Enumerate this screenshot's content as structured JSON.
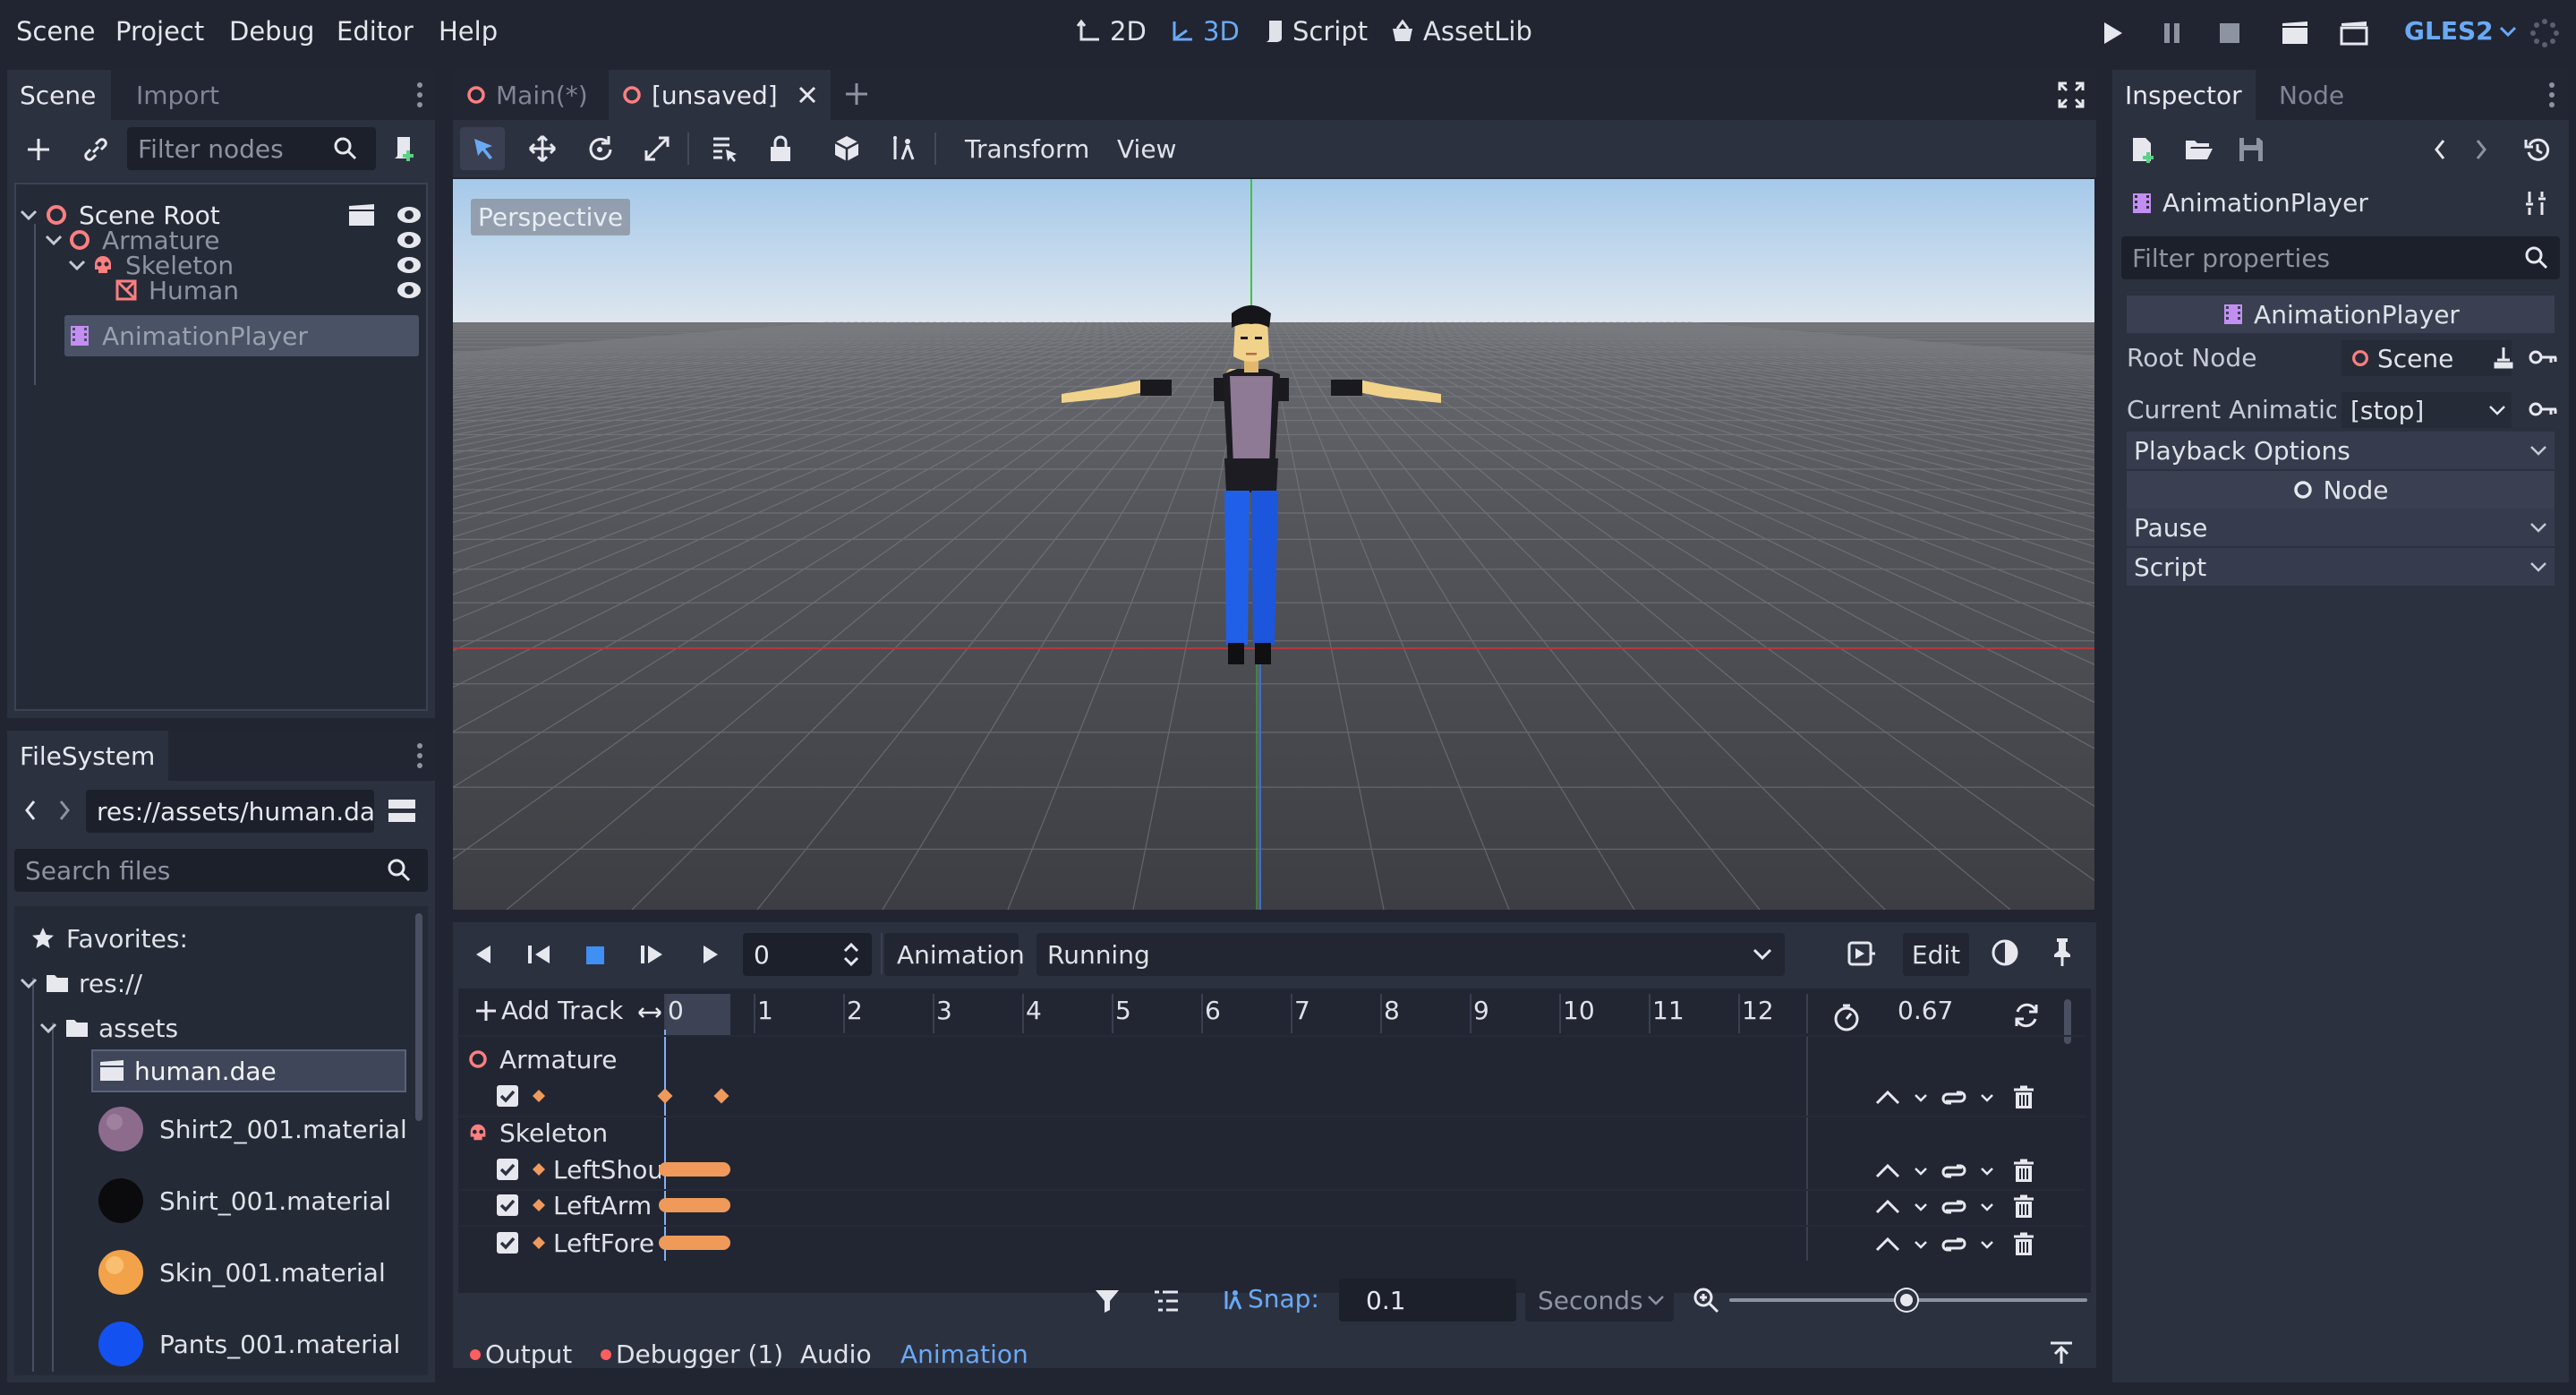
{
  "menu": {
    "items": [
      "Scene",
      "Project",
      "Debug",
      "Editor",
      "Help"
    ]
  },
  "workspaces": {
    "w2d": "2D",
    "w3d": "3D",
    "script": "Script",
    "assetlib": "AssetLib"
  },
  "renderer": "GLES2",
  "scene_dock": {
    "tabs": [
      "Scene",
      "Import"
    ],
    "filter_placeholder": "Filter nodes",
    "tree": [
      {
        "label": "Scene Root"
      },
      {
        "label": "Armature"
      },
      {
        "label": "Skeleton"
      },
      {
        "label": "Human"
      },
      {
        "label": "AnimationPlayer"
      }
    ]
  },
  "filesystem": {
    "tab": "FileSystem",
    "path": "res://assets/human.da",
    "search_placeholder": "Search files",
    "items": [
      {
        "label": "Favorites:"
      },
      {
        "label": "res://"
      },
      {
        "label": "assets"
      },
      {
        "label": "human.dae"
      },
      {
        "label": "Shirt2_001.material",
        "color": "#8c6b8c"
      },
      {
        "label": "Shirt_001.material",
        "color": "#0b0b0d"
      },
      {
        "label": "Skin_001.material",
        "color": "#f2a34a"
      },
      {
        "label": "Pants_001.material",
        "color": "#1352f0"
      }
    ]
  },
  "editor_tabs": [
    {
      "label": "Main(*)"
    },
    {
      "label": "[unsaved]"
    }
  ],
  "viewport_toolbar": {
    "transform": "Transform",
    "view": "View"
  },
  "viewport": {
    "label": "Perspective"
  },
  "animation": {
    "position": "0",
    "animation_label": "Animation",
    "current": "Running",
    "edit": "Edit",
    "add_track": "Add Track",
    "ticks": [
      "0",
      "1",
      "2",
      "3",
      "4",
      "5",
      "6",
      "7",
      "8",
      "9",
      "10",
      "11",
      "12"
    ],
    "length": "0.67",
    "groups": [
      {
        "label": "Armature"
      },
      {
        "label": "Skeleton"
      }
    ],
    "tracks": [
      {
        "label": "LeftShou"
      },
      {
        "label": "LeftArm"
      },
      {
        "label": "LeftFore"
      }
    ],
    "snap_label": "Snap:",
    "snap_value": "0.1",
    "snap_unit": "Seconds"
  },
  "bottom_tabs": [
    {
      "label": "Output"
    },
    {
      "label": "Debugger (1)"
    },
    {
      "label": "Audio"
    },
    {
      "label": "Animation"
    }
  ],
  "inspector": {
    "tabs": [
      "Inspector",
      "Node"
    ],
    "object": "AnimationPlayer",
    "filter_placeholder": "Filter properties",
    "class_header": "AnimationPlayer",
    "root_node_label": "Root Node",
    "root_node_value": "Scene",
    "current_anim_label": "Current Animatio",
    "current_anim_value": "[stop]",
    "playback_options": "Playback Options",
    "node_header": "Node",
    "pause": "Pause",
    "script": "Script"
  }
}
